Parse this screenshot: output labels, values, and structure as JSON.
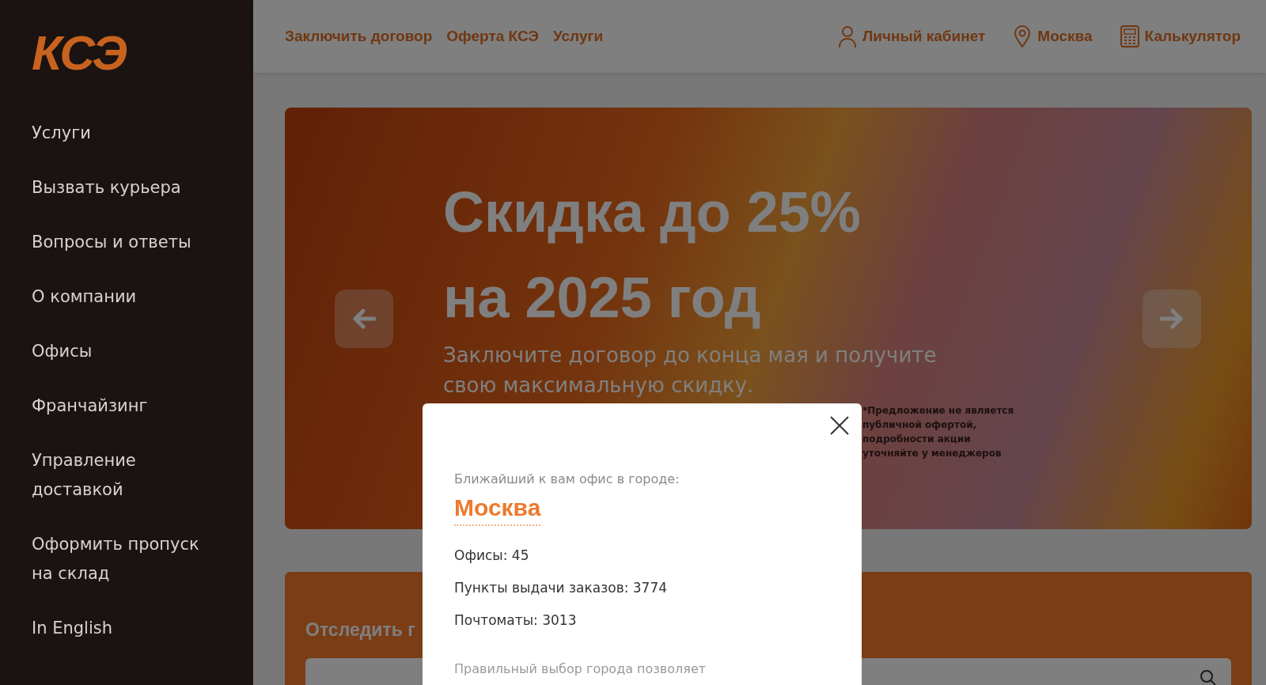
{
  "logo": {
    "text": "КСЭ"
  },
  "sidebar": {
    "items": [
      {
        "label": "Услуги"
      },
      {
        "label": "Вызвать курьера"
      },
      {
        "label": "Вопросы и ответы"
      },
      {
        "label": "О компании"
      },
      {
        "label": "Офисы"
      },
      {
        "label": "Франчайзинг"
      },
      {
        "label": "Управление доставкой"
      },
      {
        "label": "Оформить пропуск на склад"
      },
      {
        "label": "In English"
      }
    ]
  },
  "header": {
    "links": [
      "Заключить договор",
      "Оферта КСЭ",
      "Услуги"
    ],
    "actions": [
      {
        "kind": "user",
        "label": "Личный кабинет"
      },
      {
        "kind": "location",
        "label": "Москва"
      },
      {
        "kind": "calculator",
        "label": "Калькулятор"
      }
    ]
  },
  "banner": {
    "title_lines": [
      "Скидка до 25%",
      "на 2025 год"
    ],
    "subtitle": "Заключите договор до конца мая и получите свою максимальную скидку.",
    "disclaimer": "*Предложение не является публичной офертой, подробности акции уточняйте у менеджеров"
  },
  "tracking": {
    "title": "Отследить г"
  },
  "modal": {
    "caption": "Ближайший к вам офис в городе:",
    "city": "Москва",
    "stats": [
      "Офисы: 45",
      "Пункты выдачи заказов: 3774",
      "Почтоматы: 3013"
    ],
    "note": "Правильный выбор города позволяет"
  }
}
